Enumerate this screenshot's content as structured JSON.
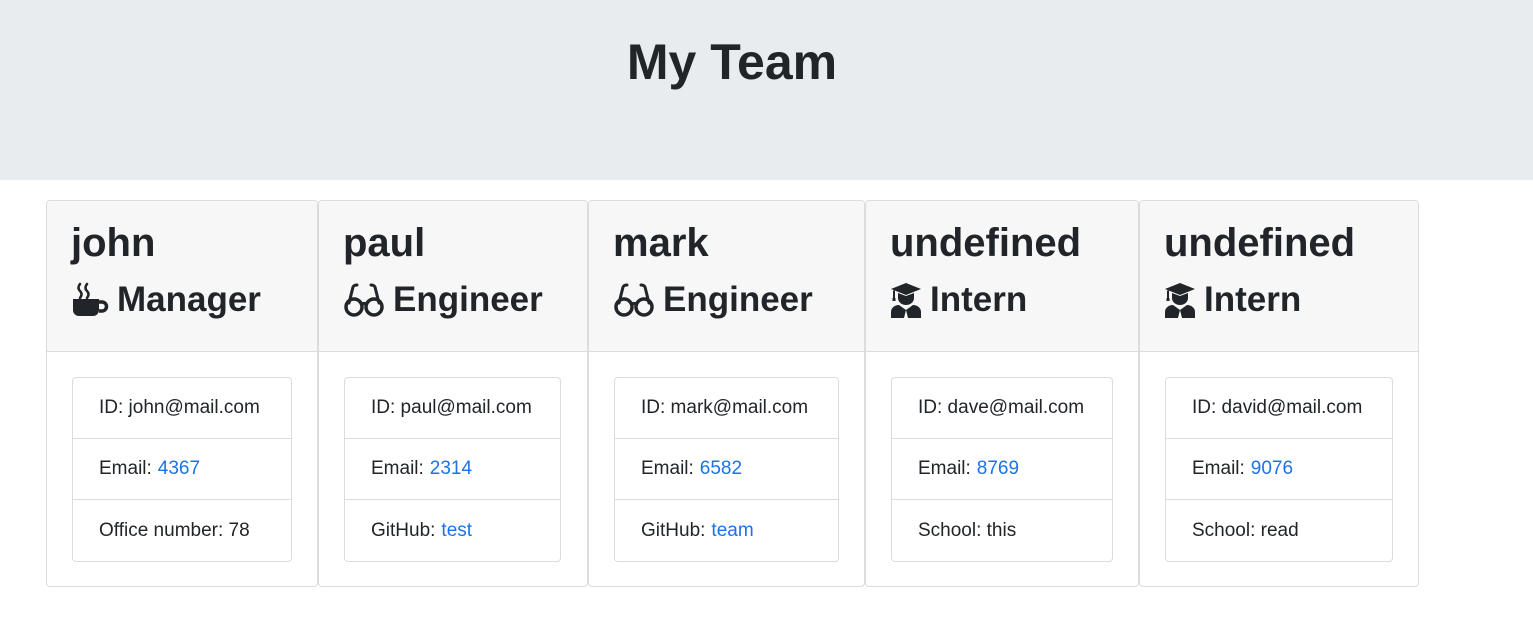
{
  "header": {
    "title": "My Team"
  },
  "cards": [
    {
      "name": "john",
      "role": "Manager",
      "role_icon": "coffee-icon",
      "id_label": "ID: john@mail.com",
      "email_label": "Email:",
      "email_value": "4367",
      "extra_label": "Office number: 78",
      "extra_link": ""
    },
    {
      "name": "paul",
      "role": "Engineer",
      "role_icon": "glasses-icon",
      "id_label": "ID: paul@mail.com",
      "email_label": "Email:",
      "email_value": "2314",
      "extra_label": "GitHub:",
      "extra_link": "test"
    },
    {
      "name": "mark",
      "role": "Engineer",
      "role_icon": "glasses-icon",
      "id_label": "ID: mark@mail.com",
      "email_label": "Email:",
      "email_value": "6582",
      "extra_label": "GitHub:",
      "extra_link": "team"
    },
    {
      "name": "undefined",
      "role": "Intern",
      "role_icon": "graduate-icon",
      "id_label": "ID: dave@mail.com",
      "email_label": "Email:",
      "email_value": "8769",
      "extra_label": "School: this",
      "extra_link": ""
    },
    {
      "name": "undefined",
      "role": "Intern",
      "role_icon": "graduate-icon",
      "id_label": "ID: david@mail.com",
      "email_label": "Email:",
      "email_value": "9076",
      "extra_label": "School: read",
      "extra_link": ""
    }
  ],
  "colors": {
    "link": "#1a73e8",
    "header_bg": "#e9ecef",
    "card_header_bg": "#f7f7f7"
  }
}
